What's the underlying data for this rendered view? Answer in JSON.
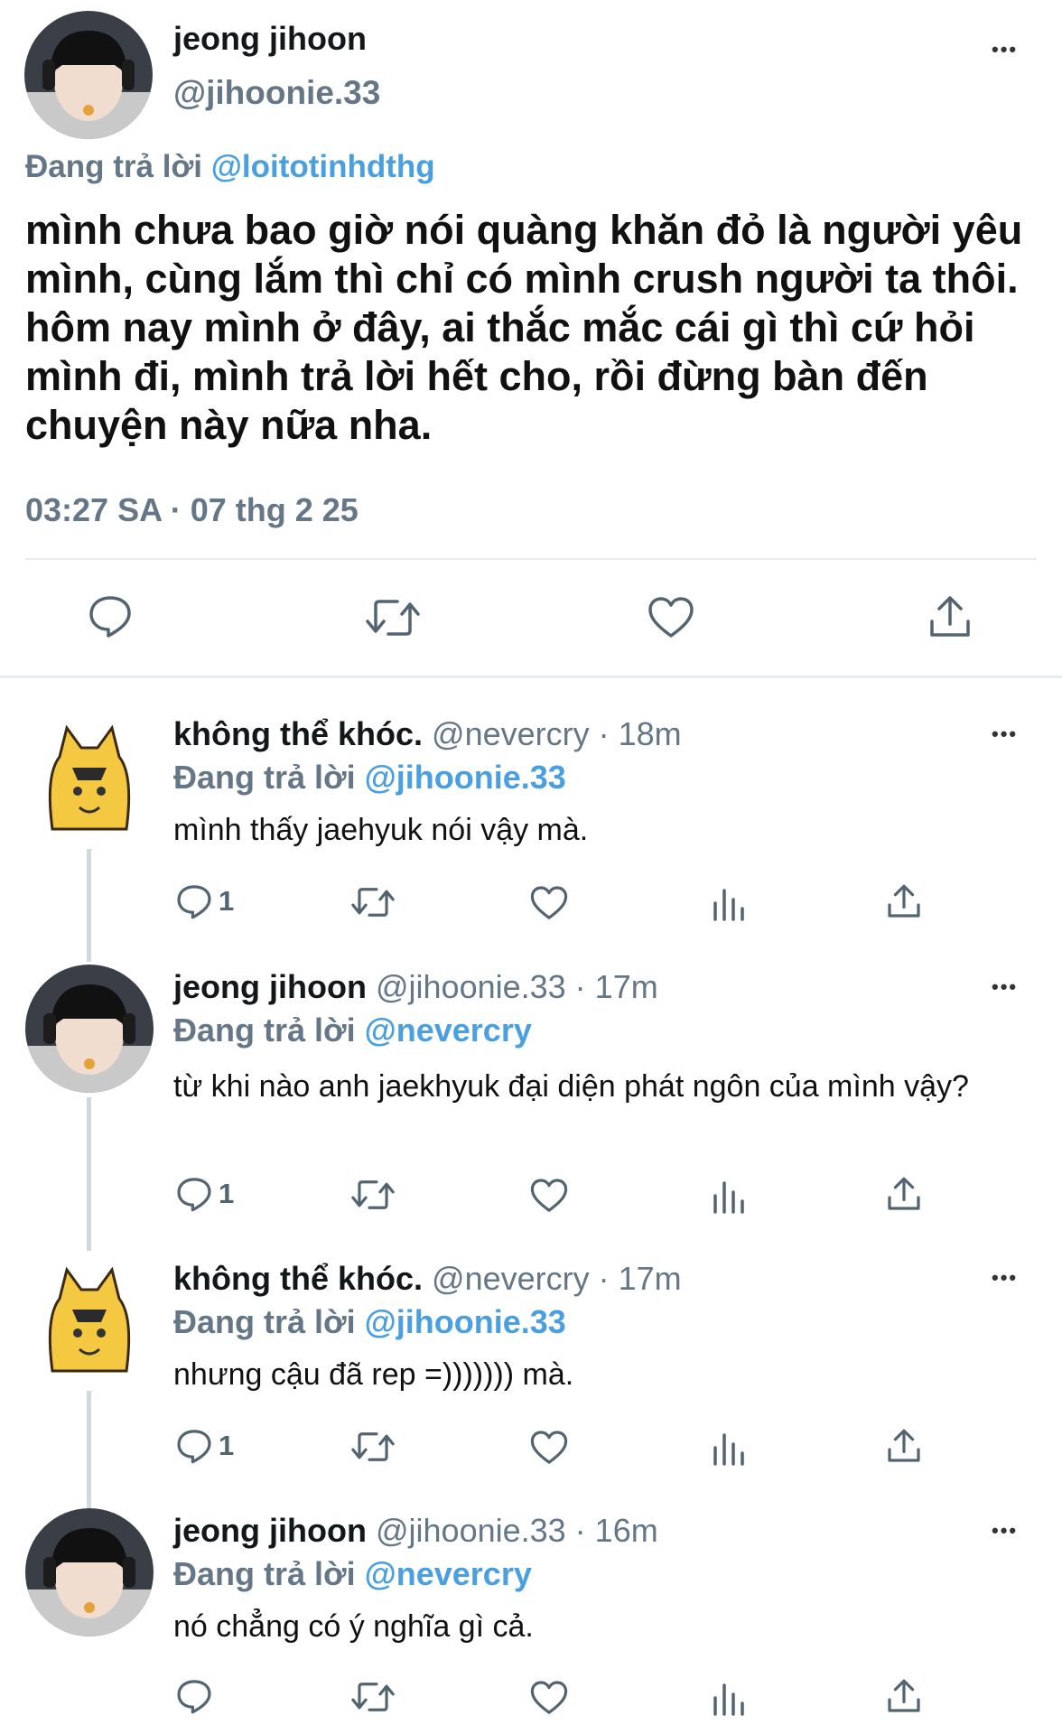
{
  "main_tweet": {
    "author_name": "jeong jihoon",
    "handle": "@jihoonie.33",
    "reply_prefix": "Đang trả lời",
    "reply_to": "@loitotinhdthg",
    "text": "mình chưa bao giờ nói quàng khăn đỏ là người yêu mình, cùng lắm thì chỉ có mình crush người ta thôi. hôm nay mình ở đây, ai thắc mắc cái gì thì cứ hỏi mình đi, mình trả lời hết cho, rồi đừng bàn đến chuyện này nữa nha.",
    "timestamp": "03:27 SA · 07 thg 2 25",
    "more_glyph": "•••"
  },
  "replies": [
    {
      "author_name": "không thể khóc.",
      "meta": "@nevercry · 18m",
      "reply_prefix": "Đang trả lời",
      "reply_to": "@jihoonie.33",
      "text": "mình thấy jaehyuk nói vậy mà.",
      "reply_count": "1",
      "more_glyph": "•••"
    },
    {
      "author_name": "jeong jihoon",
      "meta": "@jihoonie.33 · 17m",
      "reply_prefix": "Đang trả lời",
      "reply_to": "@nevercry",
      "text": "từ khi nào anh jaekhyuk đại diện phát ngôn của mình vậy?",
      "reply_count": "1",
      "more_glyph": "•••"
    },
    {
      "author_name": "không thể khóc.",
      "meta": "@nevercry · 17m",
      "reply_prefix": "Đang trả lời",
      "reply_to": "@jihoonie.33",
      "text": "nhưng cậu đã rep =))))))) mà.",
      "reply_count": "1",
      "more_glyph": "•••"
    },
    {
      "author_name": "jeong jihoon",
      "meta": "@jihoonie.33 · 16m",
      "reply_prefix": "Đang trả lời",
      "reply_to": "@nevercry",
      "text": "nó chẳng có ý nghĩa gì cả.",
      "reply_count": "",
      "more_glyph": "•••"
    }
  ],
  "colors": {
    "link_blue": "#4a9fe0",
    "secondary_text": "#657786",
    "divider": "#e6ecf0",
    "thread_line": "#cfd9de"
  },
  "icons": [
    "comment-icon",
    "retweet-icon",
    "like-icon",
    "views-icon",
    "share-icon",
    "more-icon"
  ]
}
